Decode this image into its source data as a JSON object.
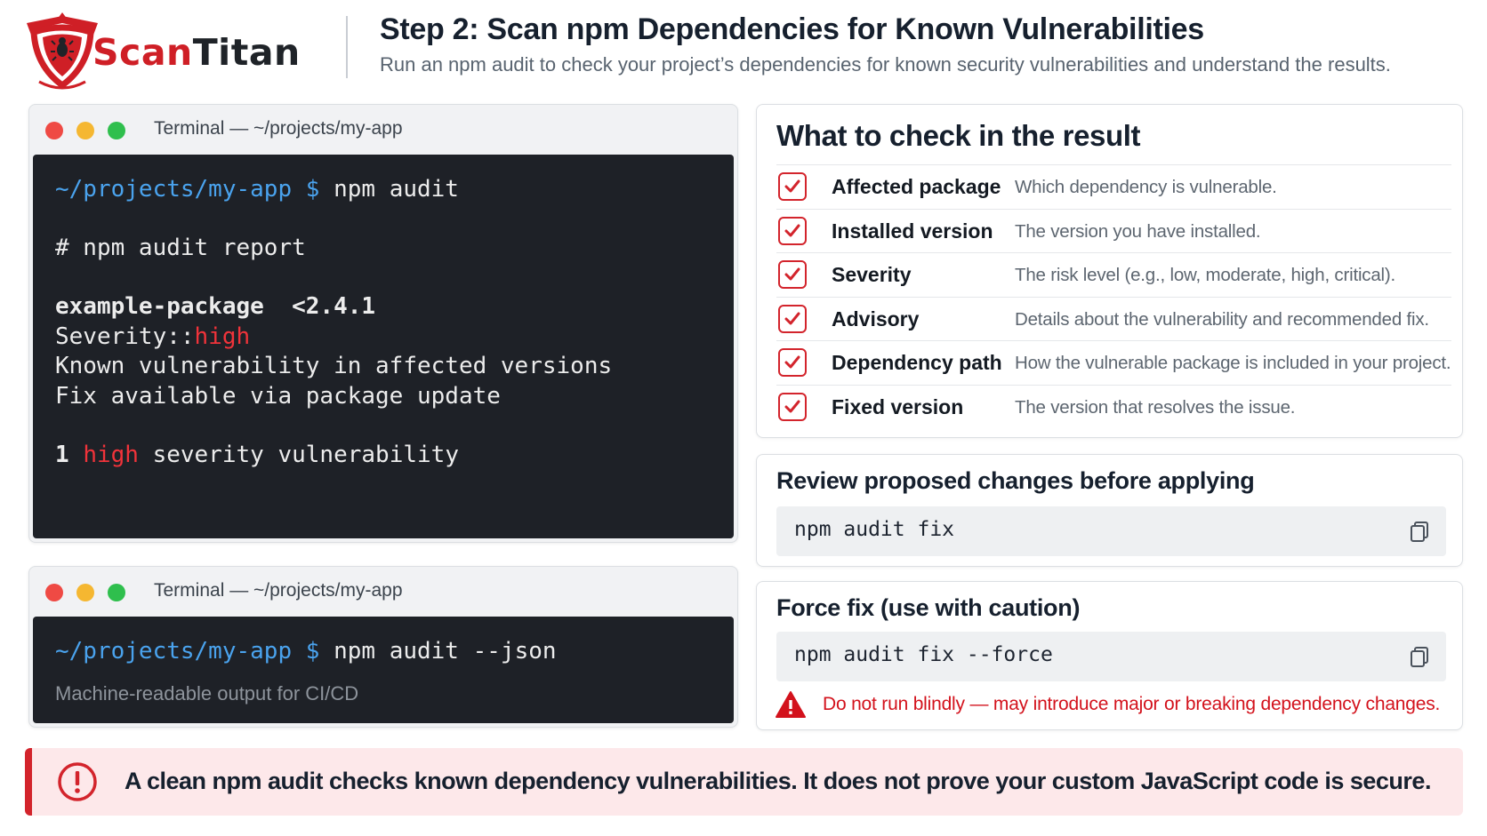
{
  "brand": {
    "name_part1": "Scan",
    "name_part2": "Titan",
    "primary_color": "#cf1f26"
  },
  "header": {
    "title": "Step 2: Scan npm Dependencies for Known Vulnerabilities",
    "subtitle": "Run an npm audit to check your project’s dependencies for known security vulnerabilities and understand the results."
  },
  "terminal_1": {
    "title": "Terminal — ~/projects/my-app",
    "prompt_path": "~/projects/my-app",
    "prompt_symbol": "$",
    "command": "npm audit",
    "report_heading": "# npm audit report",
    "package_line": "example-package  <2.4.1",
    "severity_label": "Severity::",
    "severity_value": "high",
    "line_known": "Known vulnerability in affected versions",
    "line_fix": "Fix available via package update",
    "summary_count": "1",
    "summary_level": "high",
    "summary_rest": "severity vulnerability"
  },
  "terminal_2": {
    "title": "Terminal — ~/projects/my-app",
    "prompt_path": "~/projects/my-app",
    "prompt_symbol": "$",
    "command": "npm audit --json",
    "note": "Machine-readable output for CI/CD"
  },
  "check_card": {
    "title": "What to check in the result",
    "items": [
      {
        "label": "Affected package",
        "description": "Which dependency is vulnerable."
      },
      {
        "label": "Installed version",
        "description": "The version you have installed."
      },
      {
        "label": "Severity",
        "description": "The risk level (e.g., low, moderate, high, critical)."
      },
      {
        "label": "Advisory",
        "description": "Details about the vulnerability and recommended fix."
      },
      {
        "label": "Dependency path",
        "description": "How the vulnerable package is included in your project."
      },
      {
        "label": "Fixed version",
        "description": "The version that resolves the issue."
      }
    ]
  },
  "review_card": {
    "title": "Review proposed changes before applying",
    "command": "npm audit fix",
    "copy_icon": "copy-icon"
  },
  "force_card": {
    "title": "Force fix (use with caution)",
    "command": "npm audit fix --force",
    "copy_icon": "copy-icon",
    "warning": "Do not run blindly — may introduce major or breaking dependency changes."
  },
  "banner": {
    "text": "A clean npm audit checks known dependency vulnerabilities. It does not prove your custom JavaScript code is secure.",
    "icon": "exclamation-circle-icon"
  },
  "colors": {
    "accent_red": "#d3242c",
    "terminal_bg": "#1e2127",
    "prompt_blue": "#4aa3ee",
    "severity_high": "#f0333a",
    "banner_bg": "#fde8ea"
  }
}
